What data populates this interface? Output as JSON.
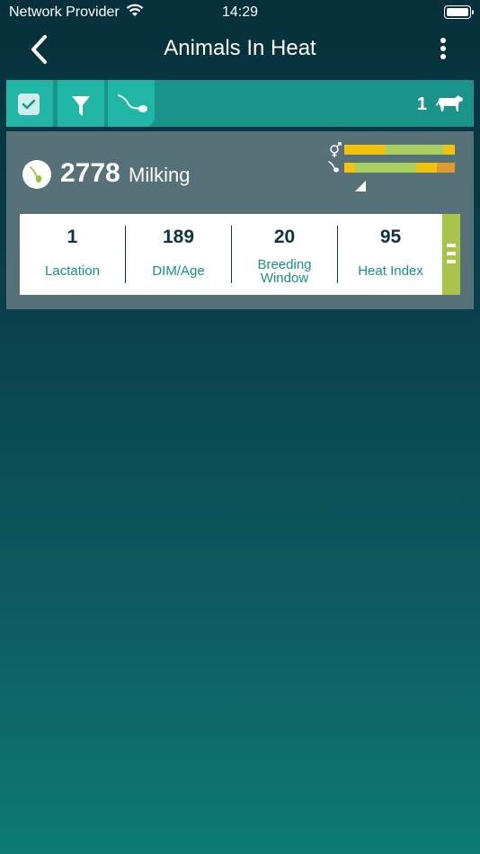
{
  "status_bar": {
    "carrier": "Network Provider",
    "time": "14:29"
  },
  "nav": {
    "title": "Animals In Heat"
  },
  "toolbar": {
    "count": "1",
    "icons": [
      "checkbox-icon",
      "filter-icon",
      "sperm-icon",
      "cow-icon"
    ]
  },
  "animal": {
    "number": "2778",
    "status": "Milking",
    "stats": [
      {
        "value": "1",
        "label": "Lactation"
      },
      {
        "value": "189",
        "label": "DIM/Age"
      },
      {
        "value": "20",
        "label_line1": "Breeding",
        "label_line2": "Window"
      },
      {
        "value": "95",
        "label": "Heat Index"
      }
    ],
    "breeding_window_bar": [
      {
        "color": "#f4c20d",
        "fraction": 0.37
      },
      {
        "color": "#a9cf5e",
        "fraction": 0.53
      },
      {
        "color": "#f4c20d",
        "fraction": 0.1
      }
    ],
    "heat_bar": [
      {
        "color": "#f4c20d",
        "fraction": 0.1
      },
      {
        "color": "#a9cf5e",
        "fraction": 0.55
      },
      {
        "color": "#f4c20d",
        "fraction": 0.19
      },
      {
        "color": "#e29a2f",
        "fraction": 0.16
      }
    ],
    "heat_marker_fraction": 0.12
  },
  "colors": {
    "toolbar_bg": "#1a948a",
    "toolbar_button": "#20b5a4",
    "card_bg": "#567178",
    "accent_green": "#a9c34b",
    "stat_value": "#0e3341",
    "stat_label": "#18908a"
  }
}
